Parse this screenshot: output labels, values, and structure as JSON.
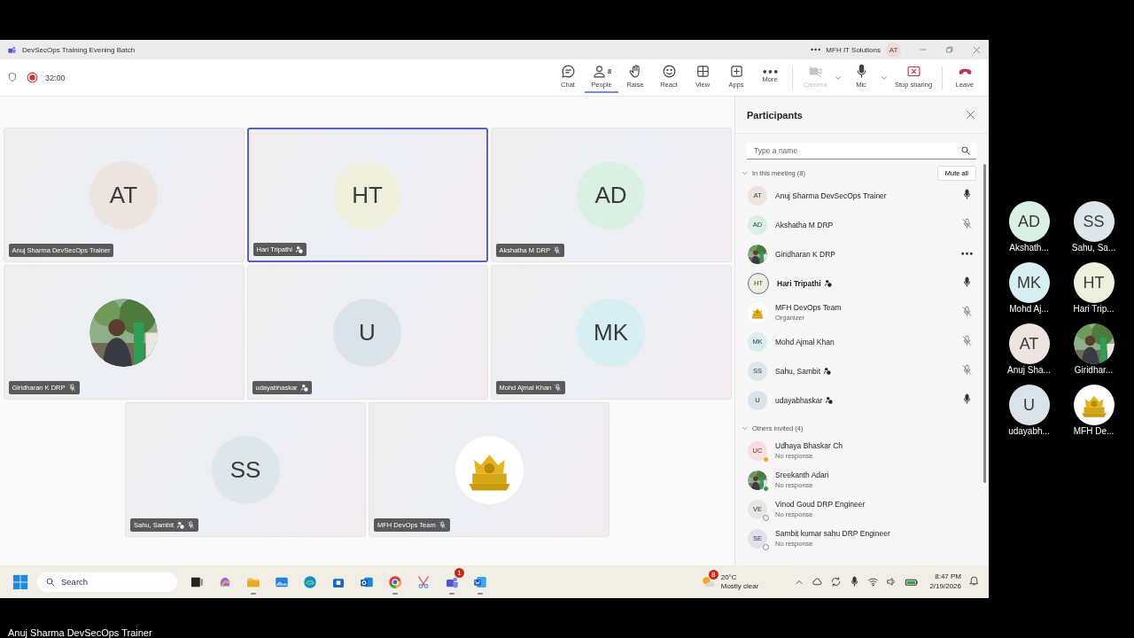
{
  "window": {
    "title": "DevSecOps Training Evening Batch",
    "org": "MFH IT Solutions",
    "account": "AT"
  },
  "meeting": {
    "timer": "32:00",
    "recording": true,
    "toolbar": [
      {
        "kind": "chat",
        "label": "Chat",
        "selected": false,
        "disabled": false,
        "dropdown": false
      },
      {
        "kind": "people",
        "label": "People",
        "badge": "8",
        "selected": true,
        "disabled": false,
        "dropdown": false
      },
      {
        "kind": "raise",
        "label": "Raise",
        "selected": false,
        "disabled": false,
        "dropdown": false
      },
      {
        "kind": "react",
        "label": "React",
        "selected": false,
        "disabled": false,
        "dropdown": false
      },
      {
        "kind": "view",
        "label": "View",
        "selected": false,
        "disabled": false,
        "dropdown": false
      },
      {
        "kind": "apps",
        "label": "Apps",
        "selected": false,
        "disabled": false,
        "dropdown": false
      },
      {
        "kind": "more",
        "label": "More",
        "selected": false,
        "disabled": false,
        "dropdown": false
      },
      {
        "kind": "camera",
        "label": "Camera",
        "selected": false,
        "disabled": true,
        "dropdown": true
      },
      {
        "kind": "mic",
        "label": "Mic",
        "selected": false,
        "disabled": false,
        "dropdown": true
      },
      {
        "kind": "share",
        "label": "Stop sharing",
        "selected": false,
        "disabled": false,
        "dropdown": false
      },
      {
        "kind": "leave",
        "label": "Leave",
        "selected": false,
        "disabled": false,
        "dropdown": false
      }
    ]
  },
  "tiles": [
    {
      "name": "Anuj Sharma DevSecOps Trainer",
      "avatar": {
        "kind": "initials",
        "text": "AT",
        "color": "#ede3df"
      },
      "external": false,
      "muted": false,
      "selected": false
    },
    {
      "name": "Hari Tripathi",
      "avatar": {
        "kind": "initials",
        "text": "HT",
        "color": "#eef0dd"
      },
      "external": true,
      "muted": false,
      "selected": true
    },
    {
      "name": "Akshatha M DRP",
      "avatar": {
        "kind": "initials",
        "text": "AD",
        "color": "#d9f0e3"
      },
      "external": false,
      "muted": true,
      "selected": false
    },
    {
      "name": "Giridharan K DRP",
      "external": false,
      "muted": true,
      "selected": false
    },
    {
      "name": "udayabhaskar",
      "avatar": {
        "kind": "initials",
        "text": "U",
        "color": "#d9e3e9"
      },
      "external": true,
      "muted": false,
      "selected": false
    },
    {
      "name": "Mohd Ajmal Khan",
      "avatar": {
        "kind": "initials",
        "text": "MK",
        "color": "#d7eff2"
      },
      "external": false,
      "muted": true,
      "selected": false
    },
    {
      "name": "Sahu, Sambit",
      "avatar": {
        "kind": "initials",
        "text": "SS",
        "color": "#dde6eb"
      },
      "external": true,
      "muted": true,
      "selected": false
    },
    {
      "name": "MFH DevOps Team",
      "avatar": {
        "kind": "logo"
      },
      "external": false,
      "muted": true,
      "selected": false
    }
  ],
  "participants": {
    "title": "Participants",
    "search_placeholder": "Type a name",
    "in_meeting": {
      "label": "In this meeting (8)",
      "expanded": true,
      "action": "Mute all",
      "people": [
        {
          "name": "Anuj Sharma DevSecOps Trainer",
          "avatar": {
            "kind": "initials",
            "text": "AT",
            "color": "#ede3df"
          },
          "external": false,
          "speaking": false,
          "kind": "mic"
        },
        {
          "name": "Akshatha M DRP",
          "avatar": {
            "kind": "initials",
            "text": "AD",
            "color": "#d9f0e3"
          },
          "external": false,
          "speaking": false,
          "kind": "muted"
        },
        {
          "name": "Giridharan K DRP",
          "external": false,
          "speaking": false,
          "kind": "more"
        },
        {
          "name": "Hari Tripathi",
          "avatar": {
            "kind": "initials",
            "text": "HT",
            "color": "#eef0dd"
          },
          "external": true,
          "speaking": true,
          "kind": "mic"
        },
        {
          "name": "MFH DevOps Team",
          "subtitle": "Organizer",
          "avatar": {
            "kind": "logo"
          },
          "external": false,
          "speaking": false,
          "kind": "muted"
        },
        {
          "name": "Mohd Ajmal Khan",
          "avatar": {
            "kind": "initials",
            "text": "MK",
            "color": "#d7eff2"
          },
          "external": false,
          "speaking": false,
          "kind": "muted"
        },
        {
          "name": "Sahu, Sambit",
          "avatar": {
            "kind": "initials",
            "text": "SS",
            "color": "#dde6eb"
          },
          "external": true,
          "speaking": false,
          "kind": "muted"
        },
        {
          "name": "udayabhaskar",
          "avatar": {
            "kind": "initials",
            "text": "U",
            "color": "#d9e3e9"
          },
          "external": true,
          "speaking": false,
          "kind": "mic"
        }
      ]
    },
    "invited": {
      "label": "Others invited (4)",
      "expanded": true,
      "people": [
        {
          "name": "Udhaya Bhaskar Ch",
          "subtitle": "No response",
          "avatar": {
            "kind": "initials",
            "text": "UC",
            "color": "#f8dede"
          },
          "kind": "away"
        },
        {
          "name": "Sreekanth Adari",
          "subtitle": "No response",
          "kind": "available"
        },
        {
          "name": "Vinod Goud DRP Engineer",
          "subtitle": "No response",
          "avatar": {
            "kind": "initials",
            "text": "VE",
            "color": "#e3e8e0"
          },
          "kind": "offline"
        },
        {
          "name": "Sambit kumar sahu DRP Engineer",
          "subtitle": "No response",
          "avatar": {
            "kind": "initials",
            "text": "SE",
            "color": "#e3e0f3"
          },
          "kind": "offline"
        }
      ]
    }
  },
  "taskbar": {
    "search_placeholder": "Search",
    "apps": [
      {
        "kind": "taskview",
        "running": false
      },
      {
        "kind": "copilot",
        "running": false
      },
      {
        "kind": "folder",
        "running": true
      },
      {
        "kind": "photos",
        "running": false
      },
      {
        "kind": "edge",
        "running": false
      },
      {
        "kind": "store",
        "running": false
      },
      {
        "kind": "outlook",
        "running": false
      },
      {
        "kind": "chrome",
        "running": true
      },
      {
        "kind": "snip",
        "running": false
      },
      {
        "kind": "teams",
        "running": true,
        "badge": "1"
      },
      {
        "kind": "word",
        "running": true
      }
    ],
    "weather": {
      "badge": "8",
      "temp": "20°C",
      "summary": "Mostly clear"
    },
    "time": "8:47 PM",
    "date": "2/19/2026"
  },
  "side_avatars": [
    {
      "label": "Akshath...",
      "avatar": {
        "kind": "initials",
        "text": "AD",
        "color": "#d9f0e3"
      }
    },
    {
      "label": "Sahu, Sa...",
      "avatar": {
        "kind": "initials",
        "text": "SS",
        "color": "#dde6eb"
      }
    },
    {
      "label": "Mohd Aj...",
      "avatar": {
        "kind": "initials",
        "text": "MK",
        "color": "#d7eff2"
      }
    },
    {
      "label": "Hari Trip...",
      "avatar": {
        "kind": "initials",
        "text": "HT",
        "color": "#eef0dd"
      }
    },
    {
      "label": "Anuj Sha...",
      "avatar": {
        "kind": "initials",
        "text": "AT",
        "color": "#ede3df"
      }
    },
    {
      "label": "Giridhar..."
    },
    {
      "label": "udayabh...",
      "avatar": {
        "kind": "initials",
        "text": "U",
        "color": "#d9e3e9"
      }
    },
    {
      "label": "MFH De...",
      "avatar": {
        "kind": "logo"
      }
    }
  ],
  "caption": "Anuj Sharma DevSecOps Trainer"
}
